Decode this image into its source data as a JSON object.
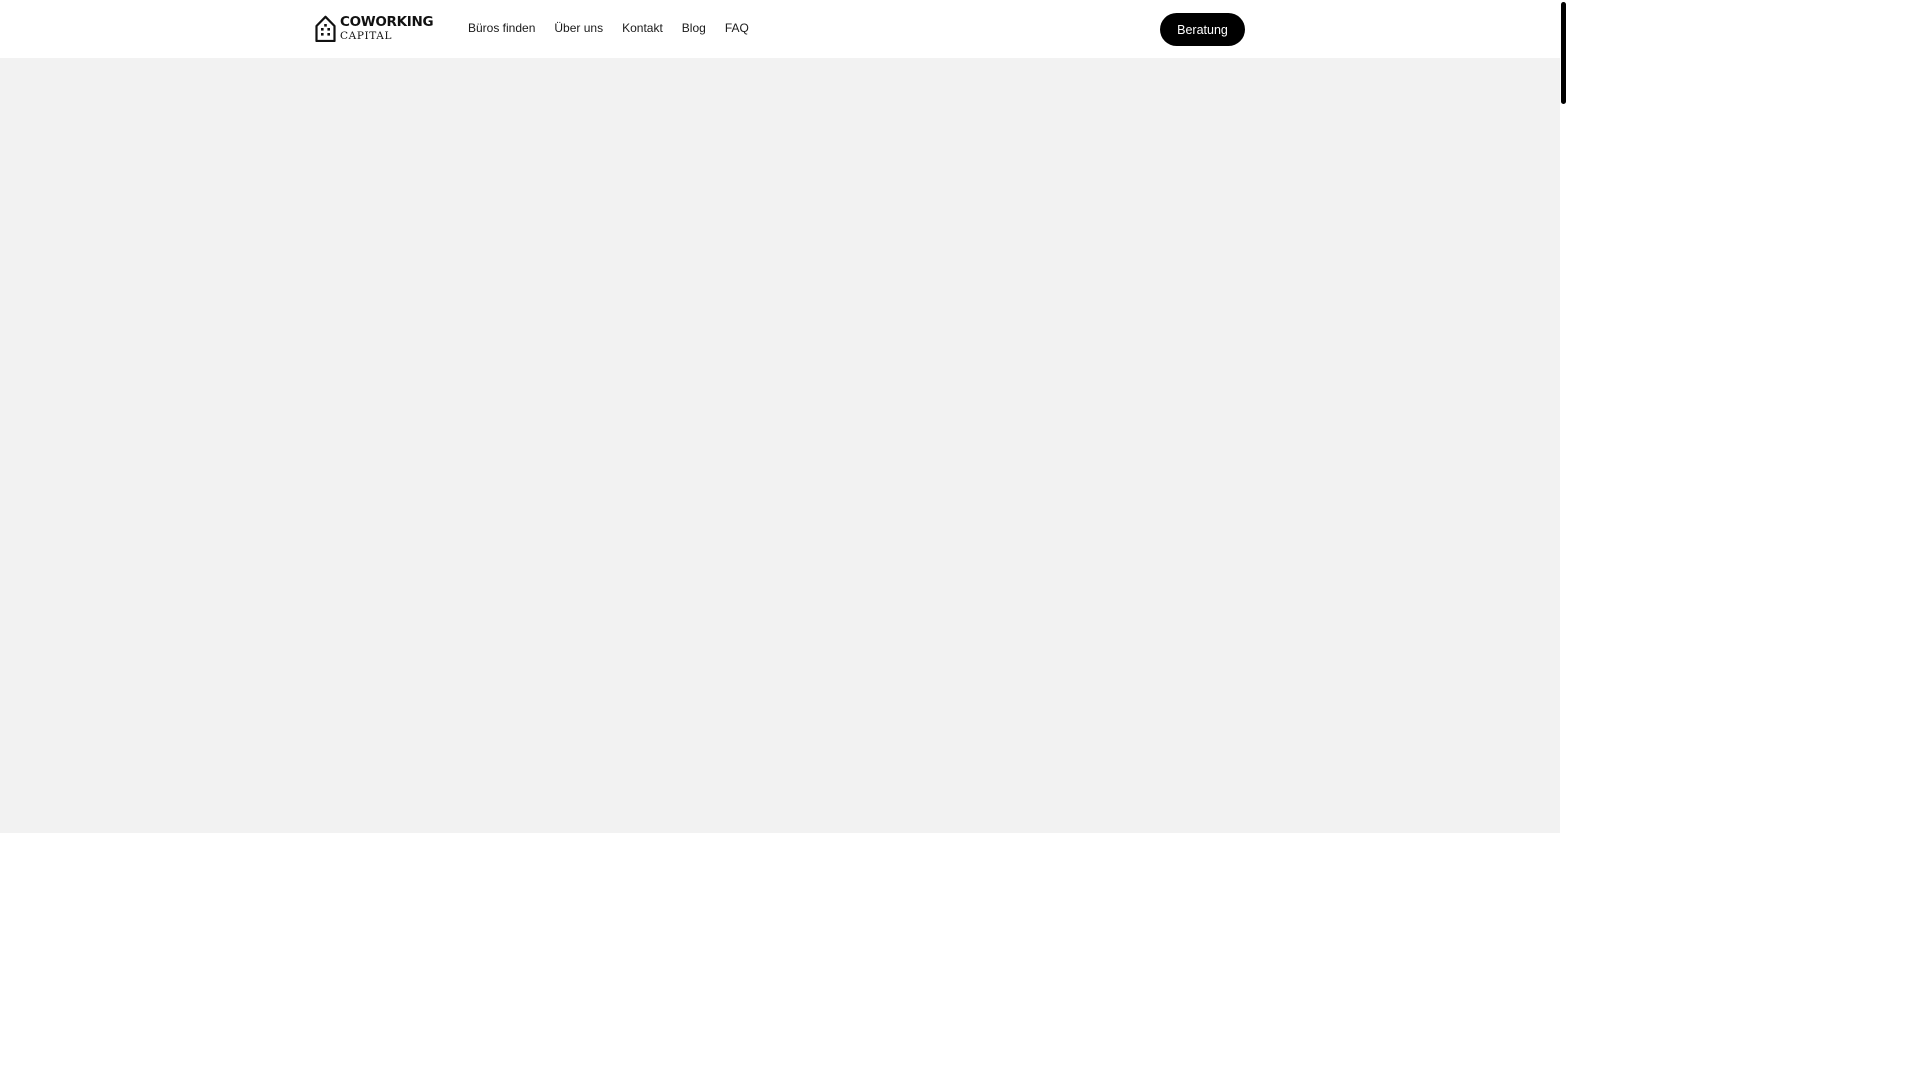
{
  "brand": {
    "line1": "COWORKING",
    "line2": "CAPITAL",
    "icon": "building-house-icon"
  },
  "nav": {
    "items": [
      {
        "label": "Büros finden"
      },
      {
        "label": "Über uns"
      },
      {
        "label": "Kontakt"
      },
      {
        "label": "Blog"
      },
      {
        "label": "FAQ"
      }
    ]
  },
  "cta": {
    "label": "Beratung"
  },
  "colors": {
    "hero_background": "#f2f2f2",
    "cta_background": "#000000",
    "cta_text": "#ffffff",
    "scrollbar_thumb": "#000000"
  }
}
